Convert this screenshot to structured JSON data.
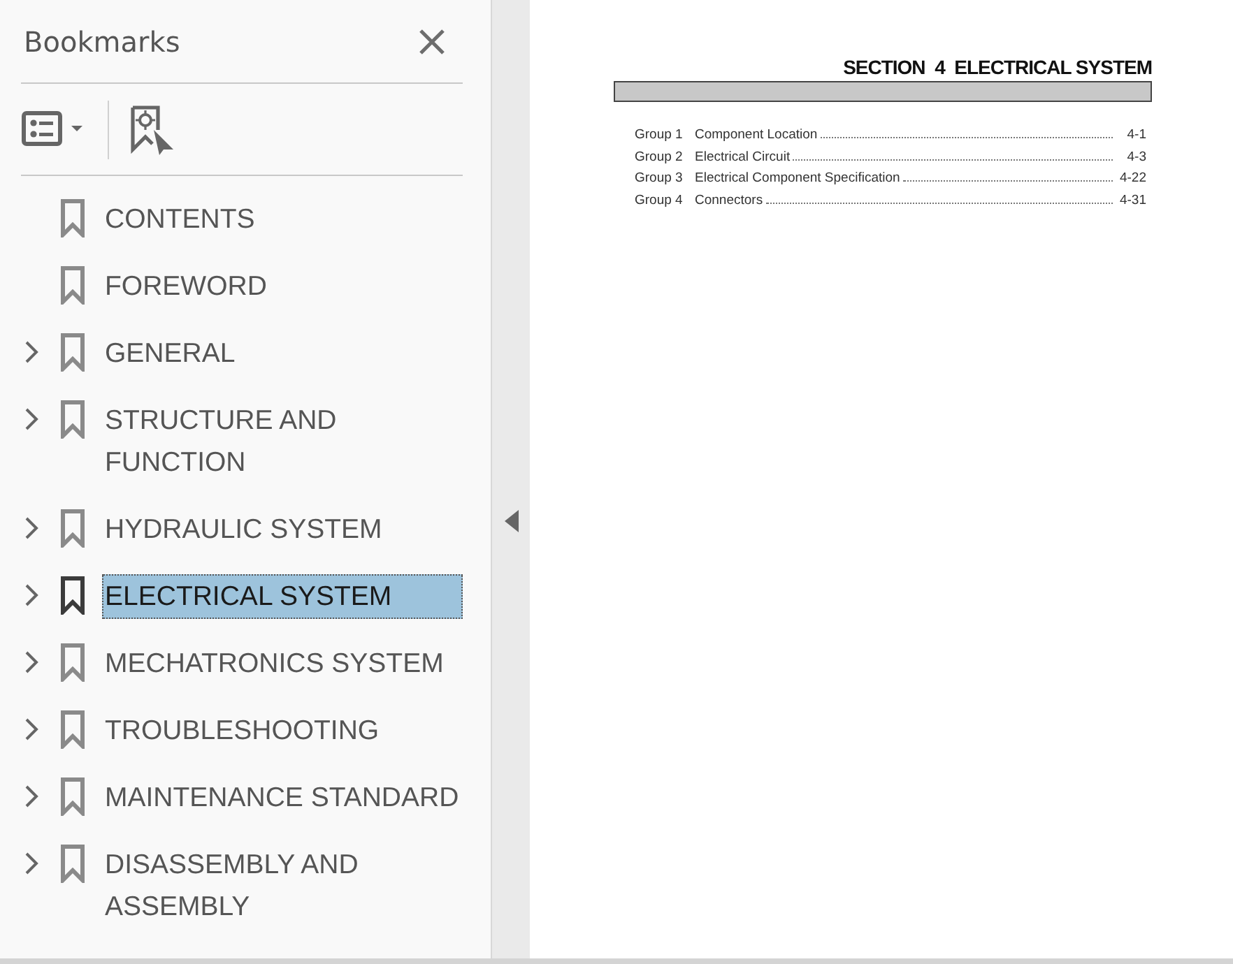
{
  "panel": {
    "title": "Bookmarks"
  },
  "bookmarks": [
    {
      "label": "CONTENTS",
      "expandable": false,
      "selected": false
    },
    {
      "label": "FOREWORD",
      "expandable": false,
      "selected": false
    },
    {
      "label": "GENERAL",
      "expandable": true,
      "selected": false
    },
    {
      "label": "STRUCTURE AND FUNCTION",
      "expandable": true,
      "selected": false
    },
    {
      "label": "HYDRAULIC SYSTEM",
      "expandable": true,
      "selected": false
    },
    {
      "label": "ELECTRICAL SYSTEM",
      "expandable": true,
      "selected": true
    },
    {
      "label": "MECHATRONICS SYSTEM",
      "expandable": true,
      "selected": false
    },
    {
      "label": "TROUBLESHOOTING",
      "expandable": true,
      "selected": false
    },
    {
      "label": "MAINTENANCE STANDARD",
      "expandable": true,
      "selected": false
    },
    {
      "label": "DISASSEMBLY AND ASSEMBLY",
      "expandable": true,
      "selected": false
    }
  ],
  "document": {
    "heading": "SECTION  4  ELECTRICAL SYSTEM",
    "toc": [
      {
        "group": "Group",
        "number": "1",
        "title": "Component Location",
        "page": "4-1"
      },
      {
        "group": "Group",
        "number": "2",
        "title": "Electrical Circuit",
        "page": "4-3"
      },
      {
        "group": "Group",
        "number": "3",
        "title": "Electrical Component Specification",
        "page": "4-22"
      },
      {
        "group": "Group",
        "number": "4",
        "title": "Connectors",
        "page": "4-31"
      }
    ]
  }
}
